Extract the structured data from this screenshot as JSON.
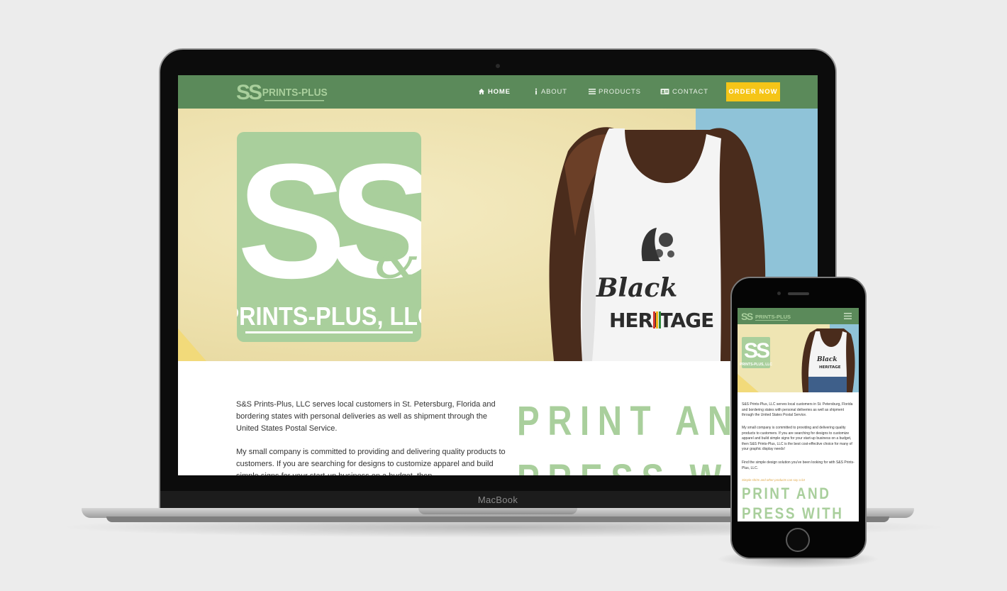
{
  "brand": {
    "name": "PRINTS-PLUS",
    "monogram": "SS",
    "ampersand": "&",
    "hero_name": "PRINTS-PLUS, LLC"
  },
  "nav": {
    "items": [
      {
        "label": "HOME",
        "icon": "home-icon",
        "active": true
      },
      {
        "label": "ABOUT",
        "icon": "info-icon",
        "active": false
      },
      {
        "label": "PRODUCTS",
        "icon": "list-icon",
        "active": false
      },
      {
        "label": "CONTACT",
        "icon": "contact-card-icon",
        "active": false
      }
    ],
    "cta": "ORDER NOW"
  },
  "hero": {
    "shirt_line1": "Black",
    "shirt_line2": "HERITAGE"
  },
  "about": {
    "p1": "S&S Prints-Plus, LLC serves local customers in St. Petersburg, Florida and bordering states with personal deliveries as well as shipment through the United States Postal Service.",
    "p2": "My small company is committed to providing and delivering quality products to customers. If you are searching for designs to customize apparel and build simple signs for your start-up business on a budget, then"
  },
  "heading": {
    "line1": "PRINT AND",
    "line2": "PRESS WITH"
  },
  "device": {
    "laptop_label": "MacBook"
  },
  "mobile": {
    "p1": "S&S Prints-Plus, LLC serves local customers in St. Petersburg, Florida and bordering states with personal deliveries as well as shipment through the United States Postal Service.",
    "p2": "My small company is committed to providing and delivering quality products to customers. If you are searching for designs to customize apparel and build simple signs for your start-up business on a budget, then S&S Prints-Plus, LLC is the best cost-effective choice for many of your graphic display needs!",
    "p3": "Find the simple design solution you've been looking for with S&S Prints-Plus, LLC.",
    "tagline": "Simple shirts and other products can say a lot",
    "heading_line1": "PRINT AND",
    "heading_line2": "PRESS WITH"
  },
  "colors": {
    "nav_green": "#5b8a5a",
    "logo_green": "#a9cf9c",
    "cta_yellow": "#f5c518",
    "hero_paper": "#efe5b3",
    "sky_blue": "#8fc3d8"
  }
}
